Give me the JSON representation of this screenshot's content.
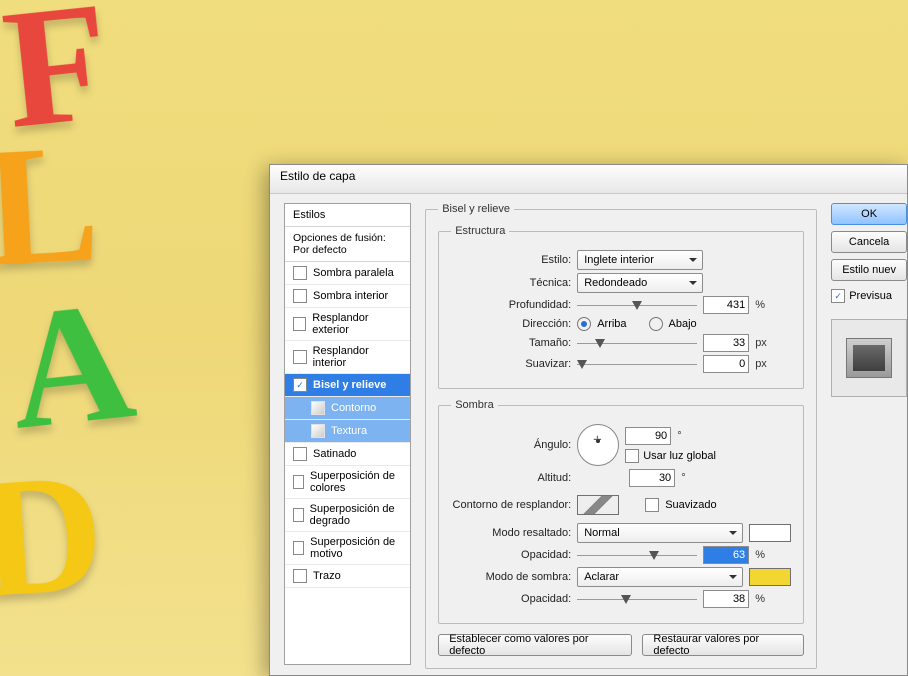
{
  "dialog": {
    "title": "Estilo de capa"
  },
  "styles_panel": {
    "header": "Estilos",
    "blend_opts": "Opciones de fusión: Por defecto",
    "items": [
      {
        "label": "Sombra paralela",
        "checked": false
      },
      {
        "label": "Sombra interior",
        "checked": false
      },
      {
        "label": "Resplandor exterior",
        "checked": false
      },
      {
        "label": "Resplandor interior",
        "checked": false
      },
      {
        "label": "Bisel y relieve",
        "checked": true,
        "selected": true
      },
      {
        "label": "Contorno",
        "checked": false,
        "indent": true,
        "sub": true
      },
      {
        "label": "Textura",
        "checked": false,
        "indent": true,
        "sub": true
      },
      {
        "label": "Satinado",
        "checked": false
      },
      {
        "label": "Superposición de colores",
        "checked": false
      },
      {
        "label": "Superposición de degrado",
        "checked": false
      },
      {
        "label": "Superposición de motivo",
        "checked": false
      },
      {
        "label": "Trazo",
        "checked": false
      }
    ]
  },
  "group_title": "Bisel y relieve",
  "structure": {
    "legend": "Estructura",
    "style_label": "Estilo:",
    "style_value": "Inglete interior",
    "technique_label": "Técnica:",
    "technique_value": "Redondeado",
    "depth_label": "Profundidad:",
    "depth_value": "431",
    "depth_unit": "%",
    "direction_label": "Dirección:",
    "dir_up": "Arriba",
    "dir_down": "Abajo",
    "size_label": "Tamaño:",
    "size_value": "33",
    "size_unit": "px",
    "soften_label": "Suavizar:",
    "soften_value": "0",
    "soften_unit": "px"
  },
  "shadow": {
    "legend": "Sombra",
    "angle_label": "Ángulo:",
    "angle_value": "90",
    "angle_unit": "°",
    "global_light": "Usar luz global",
    "altitude_label": "Altitud:",
    "altitude_value": "30",
    "altitude_unit": "°",
    "gloss_label": "Contorno de resplandor:",
    "antialias": "Suavizado",
    "highlight_mode_label": "Modo resaltado:",
    "highlight_mode_value": "Normal",
    "highlight_opacity_label": "Opacidad:",
    "highlight_opacity_value": "63",
    "highlight_opacity_unit": "%",
    "shadow_mode_label": "Modo de sombra:",
    "shadow_mode_value": "Aclarar",
    "shadow_color": "#f2d733",
    "shadow_opacity_label": "Opacidad:",
    "shadow_opacity_value": "38",
    "shadow_opacity_unit": "%"
  },
  "bottom": {
    "make_default": "Establecer como valores por defecto",
    "reset_default": "Restaurar valores por defecto"
  },
  "right": {
    "ok": "OK",
    "cancel": "Cancela",
    "new_style": "Estilo nuev",
    "preview": "Previsua"
  }
}
